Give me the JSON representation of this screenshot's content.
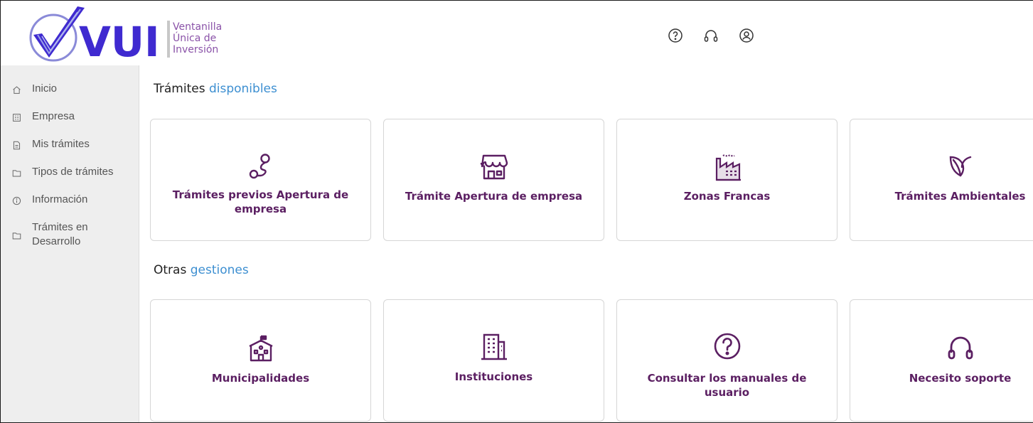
{
  "header": {
    "logo_brand": "VUI",
    "logo_lines": [
      "Ventanilla",
      "Única de",
      "Inversión"
    ],
    "icons": [
      {
        "name": "help-icon"
      },
      {
        "name": "headset-icon"
      },
      {
        "name": "user-account-icon"
      }
    ]
  },
  "sidebar": {
    "items": [
      {
        "label": "Inicio",
        "icon": "home-icon"
      },
      {
        "label": "Empresa",
        "icon": "building-icon"
      },
      {
        "label": "Mis trámites",
        "icon": "document-icon"
      },
      {
        "label": "Tipos de trámites",
        "icon": "folder-icon"
      },
      {
        "label": "Información",
        "icon": "info-icon"
      },
      {
        "label": "Trámites en Desarrollo",
        "icon": "folder-icon"
      }
    ]
  },
  "sections": {
    "available": {
      "title_plain": "Trámites",
      "title_highlight": "disponibles"
    },
    "other": {
      "title_plain": "Otras",
      "title_highlight": "gestiones"
    }
  },
  "cards_available": [
    {
      "label": "Trámites previos Apertura de empresa",
      "icon": "route-pin-icon"
    },
    {
      "label": "Trámite Apertura de empresa",
      "icon": "storefront-icon"
    },
    {
      "label": "Zonas Francas",
      "icon": "factory-icon"
    },
    {
      "label": "Trámites Ambientales",
      "icon": "leaf-icon"
    }
  ],
  "cards_other": [
    {
      "label": "Municipalidades",
      "icon": "school-building-icon"
    },
    {
      "label": "Instituciones",
      "icon": "office-building-icon"
    },
    {
      "label": "Consultar los manuales de usuario",
      "icon": "question-circle-icon"
    },
    {
      "label": "Necesito soporte",
      "icon": "headset-icon"
    }
  ],
  "colors": {
    "brand_purple": "#5b1f62",
    "brand_blue": "#3f2ad0",
    "highlight_blue": "#3d8fd1",
    "sidebar_bg": "#eeeeee"
  }
}
